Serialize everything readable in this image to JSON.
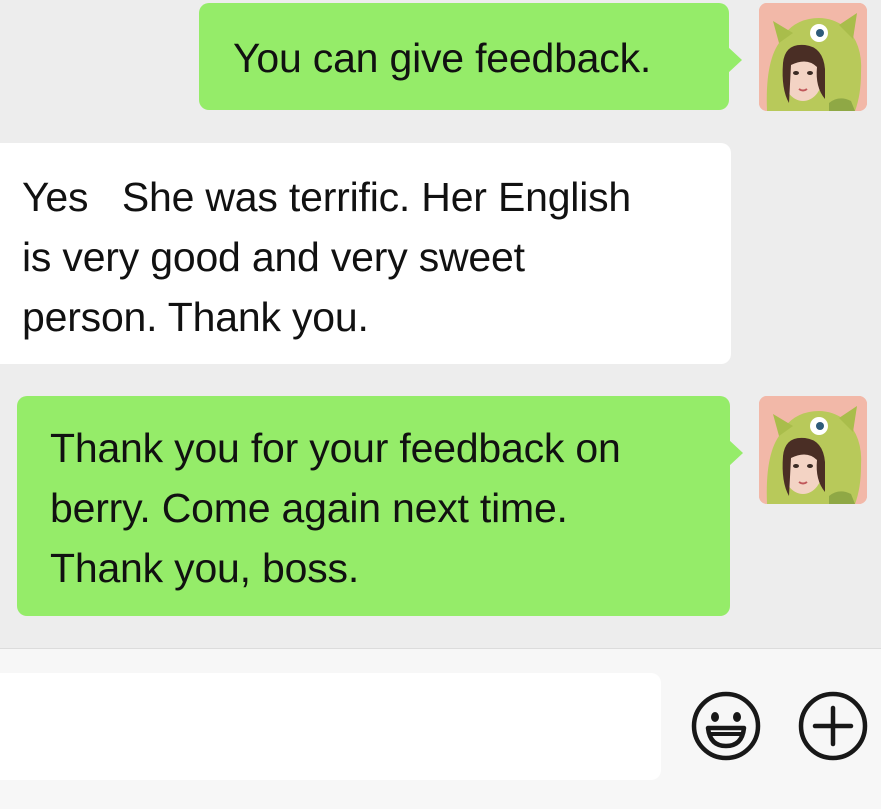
{
  "messages": [
    {
      "side": "outgoing",
      "lines": [
        "You can give feedback."
      ]
    },
    {
      "side": "incoming",
      "lines": [
        "Yes   She was terrific. Her English",
        "is very good and very sweet",
        "person. Thank you."
      ]
    },
    {
      "side": "outgoing",
      "lines": [
        "Thank you for your feedback on",
        "berry. Come again next time.",
        "Thank you, boss."
      ]
    }
  ],
  "input": {
    "value": "",
    "placeholder": ""
  },
  "icons": {
    "emoji": "smiley-face-icon",
    "plus": "plus-circle-icon",
    "avatar": "user-avatar-green-hood"
  },
  "colors": {
    "outgoing_bubble": "#95ec69",
    "incoming_bubble": "#ffffff",
    "chat_background": "#ededed",
    "input_bar_background": "#f7f7f7"
  }
}
